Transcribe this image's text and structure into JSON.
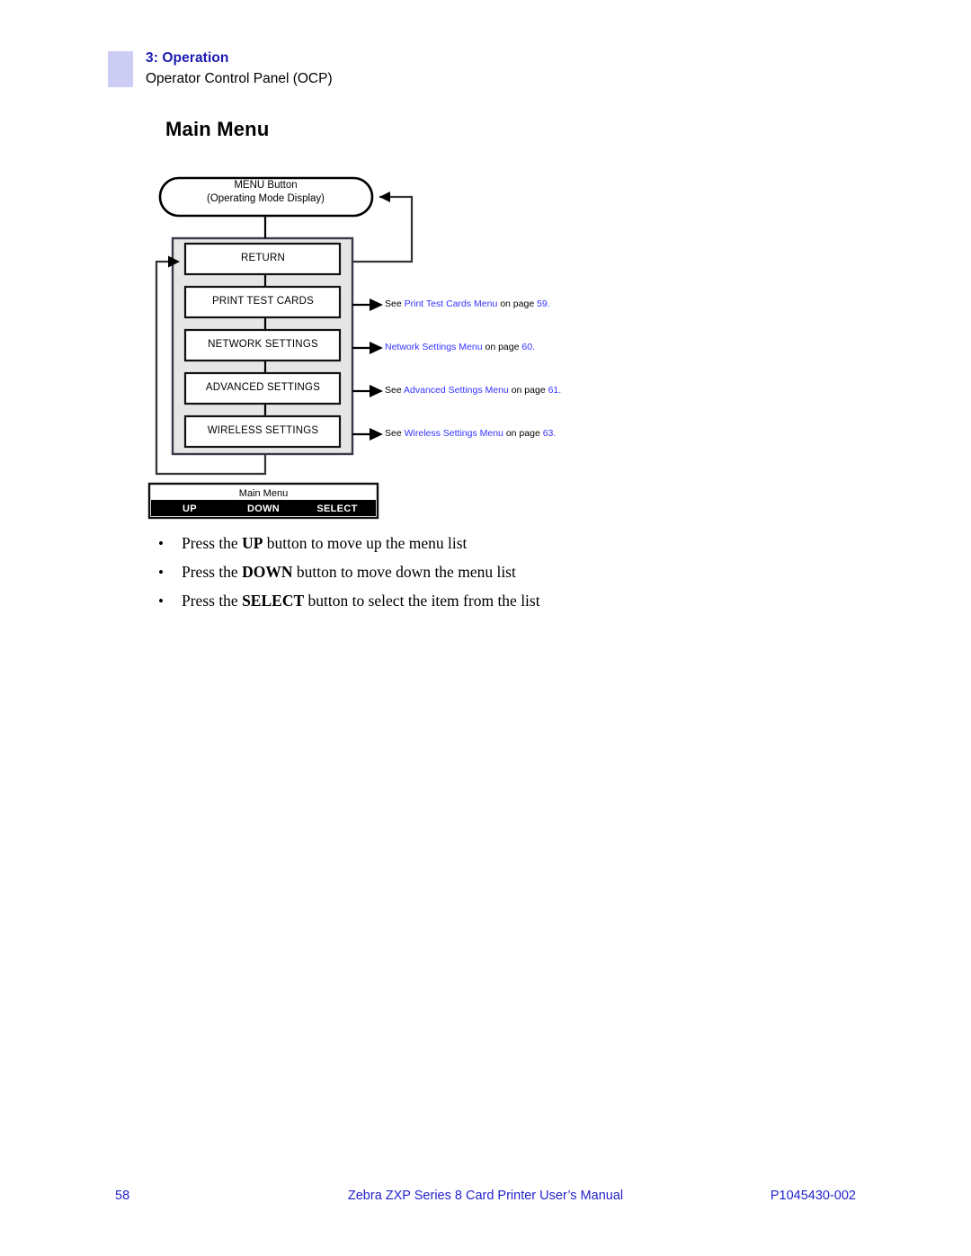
{
  "header": {
    "chapter": "3: Operation",
    "section": "Operator Control Panel (OCP)"
  },
  "main_heading": "Main Menu",
  "diagram": {
    "entry_node": {
      "line1": "MENU Button",
      "line2": "(Operating Mode Display)"
    },
    "menu_items": [
      {
        "label": "RETURN",
        "xref_prefix": "",
        "xref_link": "",
        "xref_suffix": "",
        "xref_page": ""
      },
      {
        "label": "PRINT TEST CARDS",
        "xref_prefix": "See ",
        "xref_link": "Print Test Cards Menu",
        "xref_suffix": " on page ",
        "xref_page": "59."
      },
      {
        "label": "NETWORK SETTINGS",
        "xref_prefix": "",
        "xref_link": "Network Settings Menu",
        "xref_suffix": " on page ",
        "xref_page": "60."
      },
      {
        "label": "ADVANCED SETTINGS",
        "xref_prefix": "See ",
        "xref_link": "Advanced Settings Menu",
        "xref_suffix": " on page ",
        "xref_page": "61."
      },
      {
        "label": "WIRELESS SETTINGS",
        "xref_prefix": "See ",
        "xref_link": "Wireless Settings Menu",
        "xref_suffix": " on page ",
        "xref_page": "63."
      }
    ],
    "ocp_panel": {
      "display_text": "Main Menu",
      "buttons": [
        "UP",
        "DOWN",
        "SELECT"
      ]
    },
    "colors": {
      "container_fill": "#e6e6e6",
      "link_blue": "#3333ff",
      "panel_bar": "#000000"
    }
  },
  "instructions": [
    {
      "bullet": "•",
      "before": "Press the ",
      "strong": "UP",
      "after": " button to move up the menu list"
    },
    {
      "bullet": "•",
      "before": "Press the ",
      "strong": "DOWN",
      "after": " button to move down the menu list"
    },
    {
      "bullet": "•",
      "before": "Press the ",
      "strong": "SELECT",
      "after": " button to select the item from the list"
    }
  ],
  "footer": {
    "page_number": "58",
    "title": "Zebra ZXP Series 8 Card Printer User’s Manual",
    "document_number": "P1045430-002"
  }
}
